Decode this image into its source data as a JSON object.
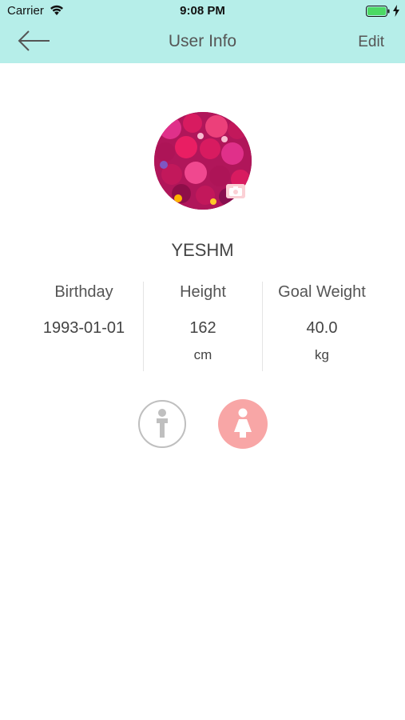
{
  "status_bar": {
    "carrier": "Carrier",
    "time": "9:08 PM"
  },
  "nav": {
    "title": "User Info",
    "edit_label": "Edit"
  },
  "profile": {
    "name": "YESHM"
  },
  "stats": [
    {
      "label": "Birthday",
      "value": "1993-01-01",
      "unit": ""
    },
    {
      "label": "Height",
      "value": "162",
      "unit": "cm"
    },
    {
      "label": "Goal Weight",
      "value": "40.0",
      "unit": "kg"
    }
  ],
  "gender": {
    "selected": "female"
  },
  "colors": {
    "header_bg": "#b6eee9",
    "female_active": "#f8a6a6",
    "male_inactive": "#bfbfbf",
    "battery": "#4cd964"
  },
  "icons": [
    "back-arrow-icon",
    "wifi-icon",
    "battery-icon",
    "charging-bolt-icon",
    "camera-icon",
    "male-icon",
    "female-icon"
  ]
}
